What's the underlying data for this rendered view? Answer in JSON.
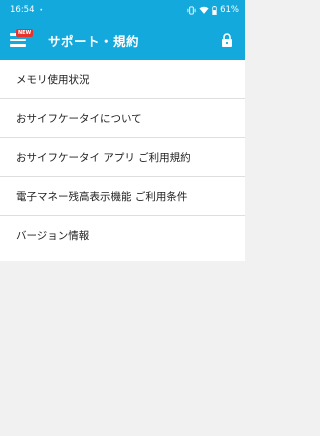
{
  "status_bar": {
    "time": "16:54",
    "dot": "•",
    "battery": "61%"
  },
  "app_bar": {
    "badge": "NEW",
    "title": "サポート・規約"
  },
  "menu": {
    "items": [
      {
        "label": "メモリ使用状況"
      },
      {
        "label": "おサイフケータイについて"
      },
      {
        "label": "おサイフケータイ アプリ ご利用規約"
      },
      {
        "label": "電子マネー残高表示機能 ご利用条件"
      },
      {
        "label": "バージョン情報"
      }
    ]
  },
  "colors": {
    "primary": "#14a9dc",
    "badge": "#e8322b"
  },
  "icons": [
    "menu-icon",
    "lock-icon",
    "vibrate-icon",
    "wifi-icon",
    "battery-icon"
  ]
}
